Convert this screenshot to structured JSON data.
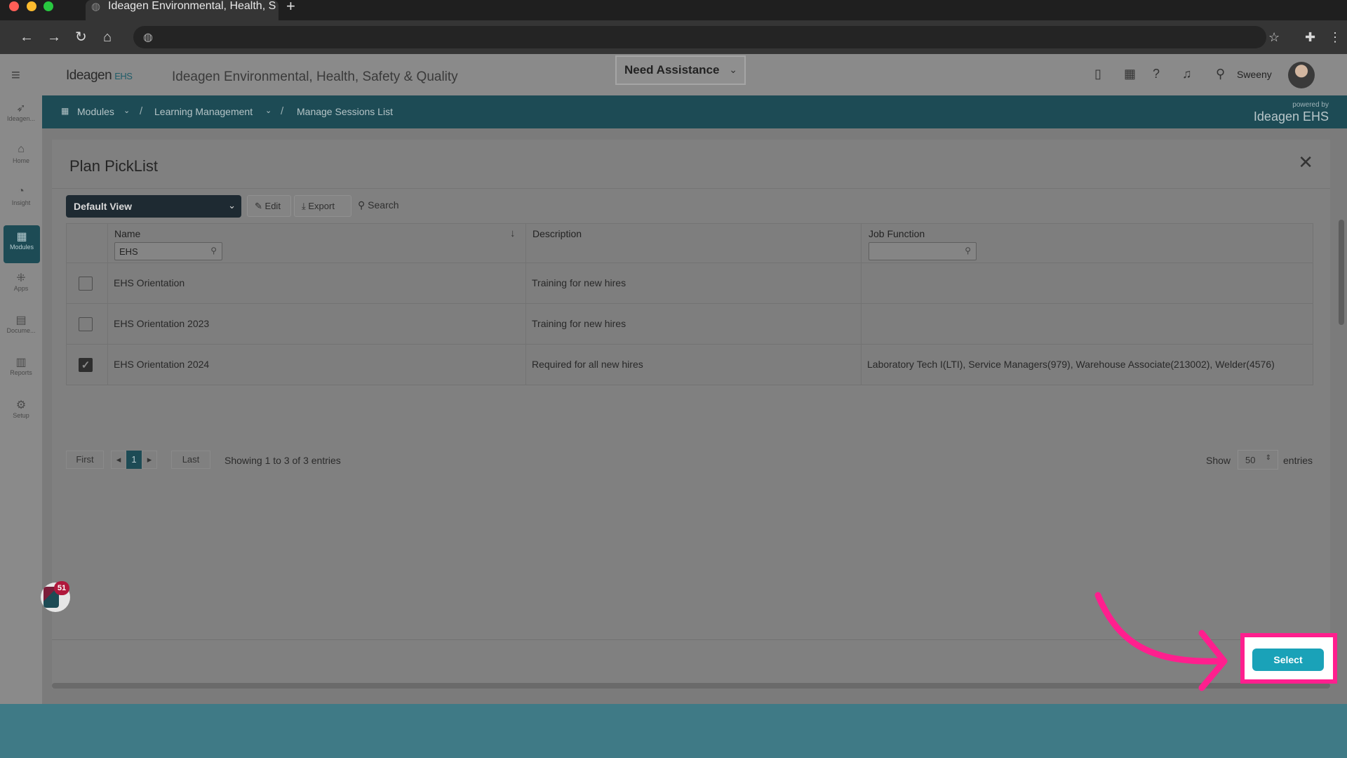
{
  "browser": {
    "tab_title": "Ideagen Environmental, Health, S",
    "new_tab": "+"
  },
  "header": {
    "logo": "Ideagen",
    "logo_suffix": "EHS",
    "app_title": "Ideagen Environmental, Health, Safety & Quality",
    "assistance": "Need Assistance",
    "user": "Sweeny"
  },
  "breadcrumb": {
    "items": [
      "Modules",
      "Learning Management",
      "Manage Sessions List"
    ],
    "powered_by": "powered by",
    "powered_brand": "Ideagen EHS"
  },
  "sidebar": {
    "items": [
      {
        "label": "Ideagen...",
        "icon": "ideagen-icon"
      },
      {
        "label": "Home",
        "icon": "home-icon"
      },
      {
        "label": "Insight",
        "icon": "insight-icon"
      },
      {
        "label": "Modules",
        "icon": "modules-icon",
        "active": true
      },
      {
        "label": "Apps",
        "icon": "apps-icon"
      },
      {
        "label": "Docume...",
        "icon": "document-icon"
      },
      {
        "label": "Reports",
        "icon": "reports-icon"
      },
      {
        "label": "Setup",
        "icon": "setup-icon"
      }
    ]
  },
  "modal": {
    "title": "Plan PickList",
    "view": "Default View",
    "edit": "Edit",
    "export": "Export",
    "search": "Search",
    "columns": [
      "Name",
      "Description",
      "Job Function"
    ],
    "name_filter": "EHS",
    "rows": [
      {
        "name": "EHS Orientation",
        "description": "Training for new hires",
        "job_function": "",
        "checked": false
      },
      {
        "name": "EHS Orientation 2023",
        "description": "Training for new hires",
        "job_function": "",
        "checked": false
      },
      {
        "name": "EHS Orientation 2024",
        "description": "Required for all new hires",
        "job_function": "Laboratory Tech I(LTI), Service Managers(979), Warehouse Associate(213002), Welder(4576)",
        "checked": true
      }
    ],
    "pager": {
      "first": "First",
      "prev": "◂",
      "page": "1",
      "next": "▸",
      "last": "Last"
    },
    "showing": "Showing 1 to 3 of 3 entries",
    "show_label": "Show",
    "page_size": "50",
    "entries_label": "entries",
    "select": "Select"
  },
  "notification_count": "51",
  "colors": {
    "accent": "#1aa2b8",
    "highlight": "#ff1f8e",
    "nav": "#1d4b55"
  }
}
